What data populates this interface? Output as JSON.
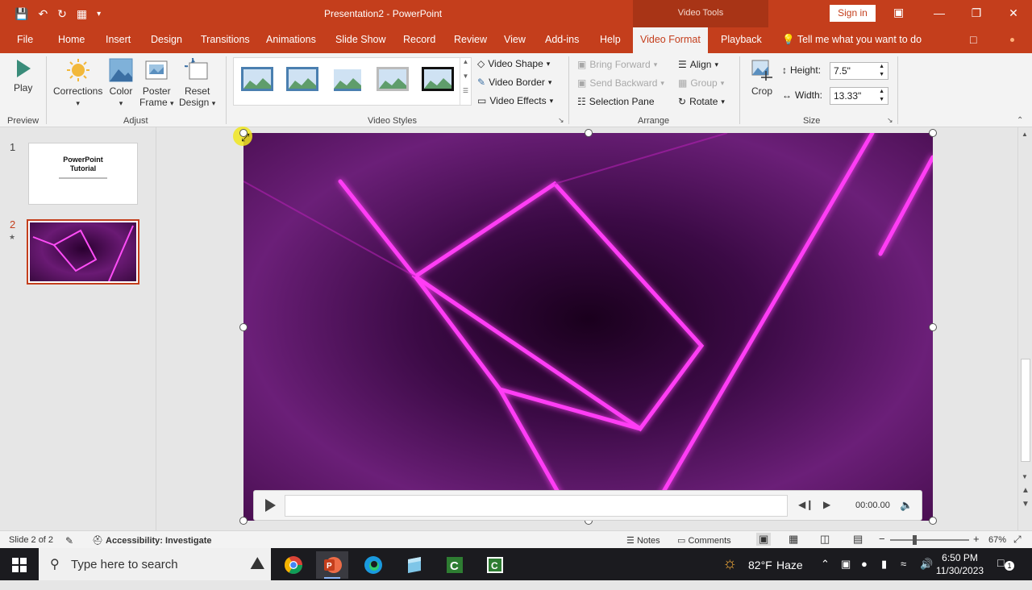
{
  "titlebar": {
    "doc_title": "Presentation2  -  PowerPoint",
    "context_tab": "Video Tools",
    "signin": "Sign in"
  },
  "menu": {
    "tabs": [
      "File",
      "Home",
      "Insert",
      "Design",
      "Transitions",
      "Animations",
      "Slide Show",
      "Record",
      "Review",
      "View",
      "Add-ins",
      "Help",
      "Video Format",
      "Playback"
    ],
    "active": "Video Format",
    "tell_me": "Tell me what you want to do"
  },
  "ribbon": {
    "preview": {
      "play": "Play",
      "group": "Preview"
    },
    "adjust": {
      "corrections": "Corrections",
      "color": "Color",
      "poster": "Poster",
      "frame": "Frame",
      "reset": "Reset",
      "design": "Design",
      "group": "Adjust"
    },
    "styles": {
      "shape": "Video Shape",
      "border": "Video Border",
      "effects": "Video Effects",
      "group": "Video Styles"
    },
    "arrange": {
      "bring_forward": "Bring Forward",
      "send_backward": "Send Backward",
      "selection_pane": "Selection Pane",
      "align": "Align",
      "group_btn": "Group",
      "rotate": "Rotate",
      "group": "Arrange"
    },
    "size": {
      "crop": "Crop",
      "height_label": "Height:",
      "height": "7.5\"",
      "width_label": "Width:",
      "width": "13.33\"",
      "group": "Size"
    }
  },
  "slides": {
    "items": [
      {
        "num": "1",
        "title_line1": "PowerPoint",
        "title_line2": "Tutorial"
      },
      {
        "num": "2"
      }
    ]
  },
  "video": {
    "time": "00:00.00"
  },
  "status": {
    "slide": "Slide 2 of 2",
    "accessibility": "Accessibility: Investigate",
    "notes": "Notes",
    "comments": "Comments",
    "zoom": "67%"
  },
  "taskbar": {
    "search_placeholder": "Type here to search",
    "weather_temp": "82°F",
    "weather_desc": "Haze",
    "time": "6:50 PM",
    "date": "11/30/2023",
    "notif_count": "1"
  },
  "colors": {
    "accent": "#c43e1c",
    "video_magenta": "#ff3df5"
  }
}
